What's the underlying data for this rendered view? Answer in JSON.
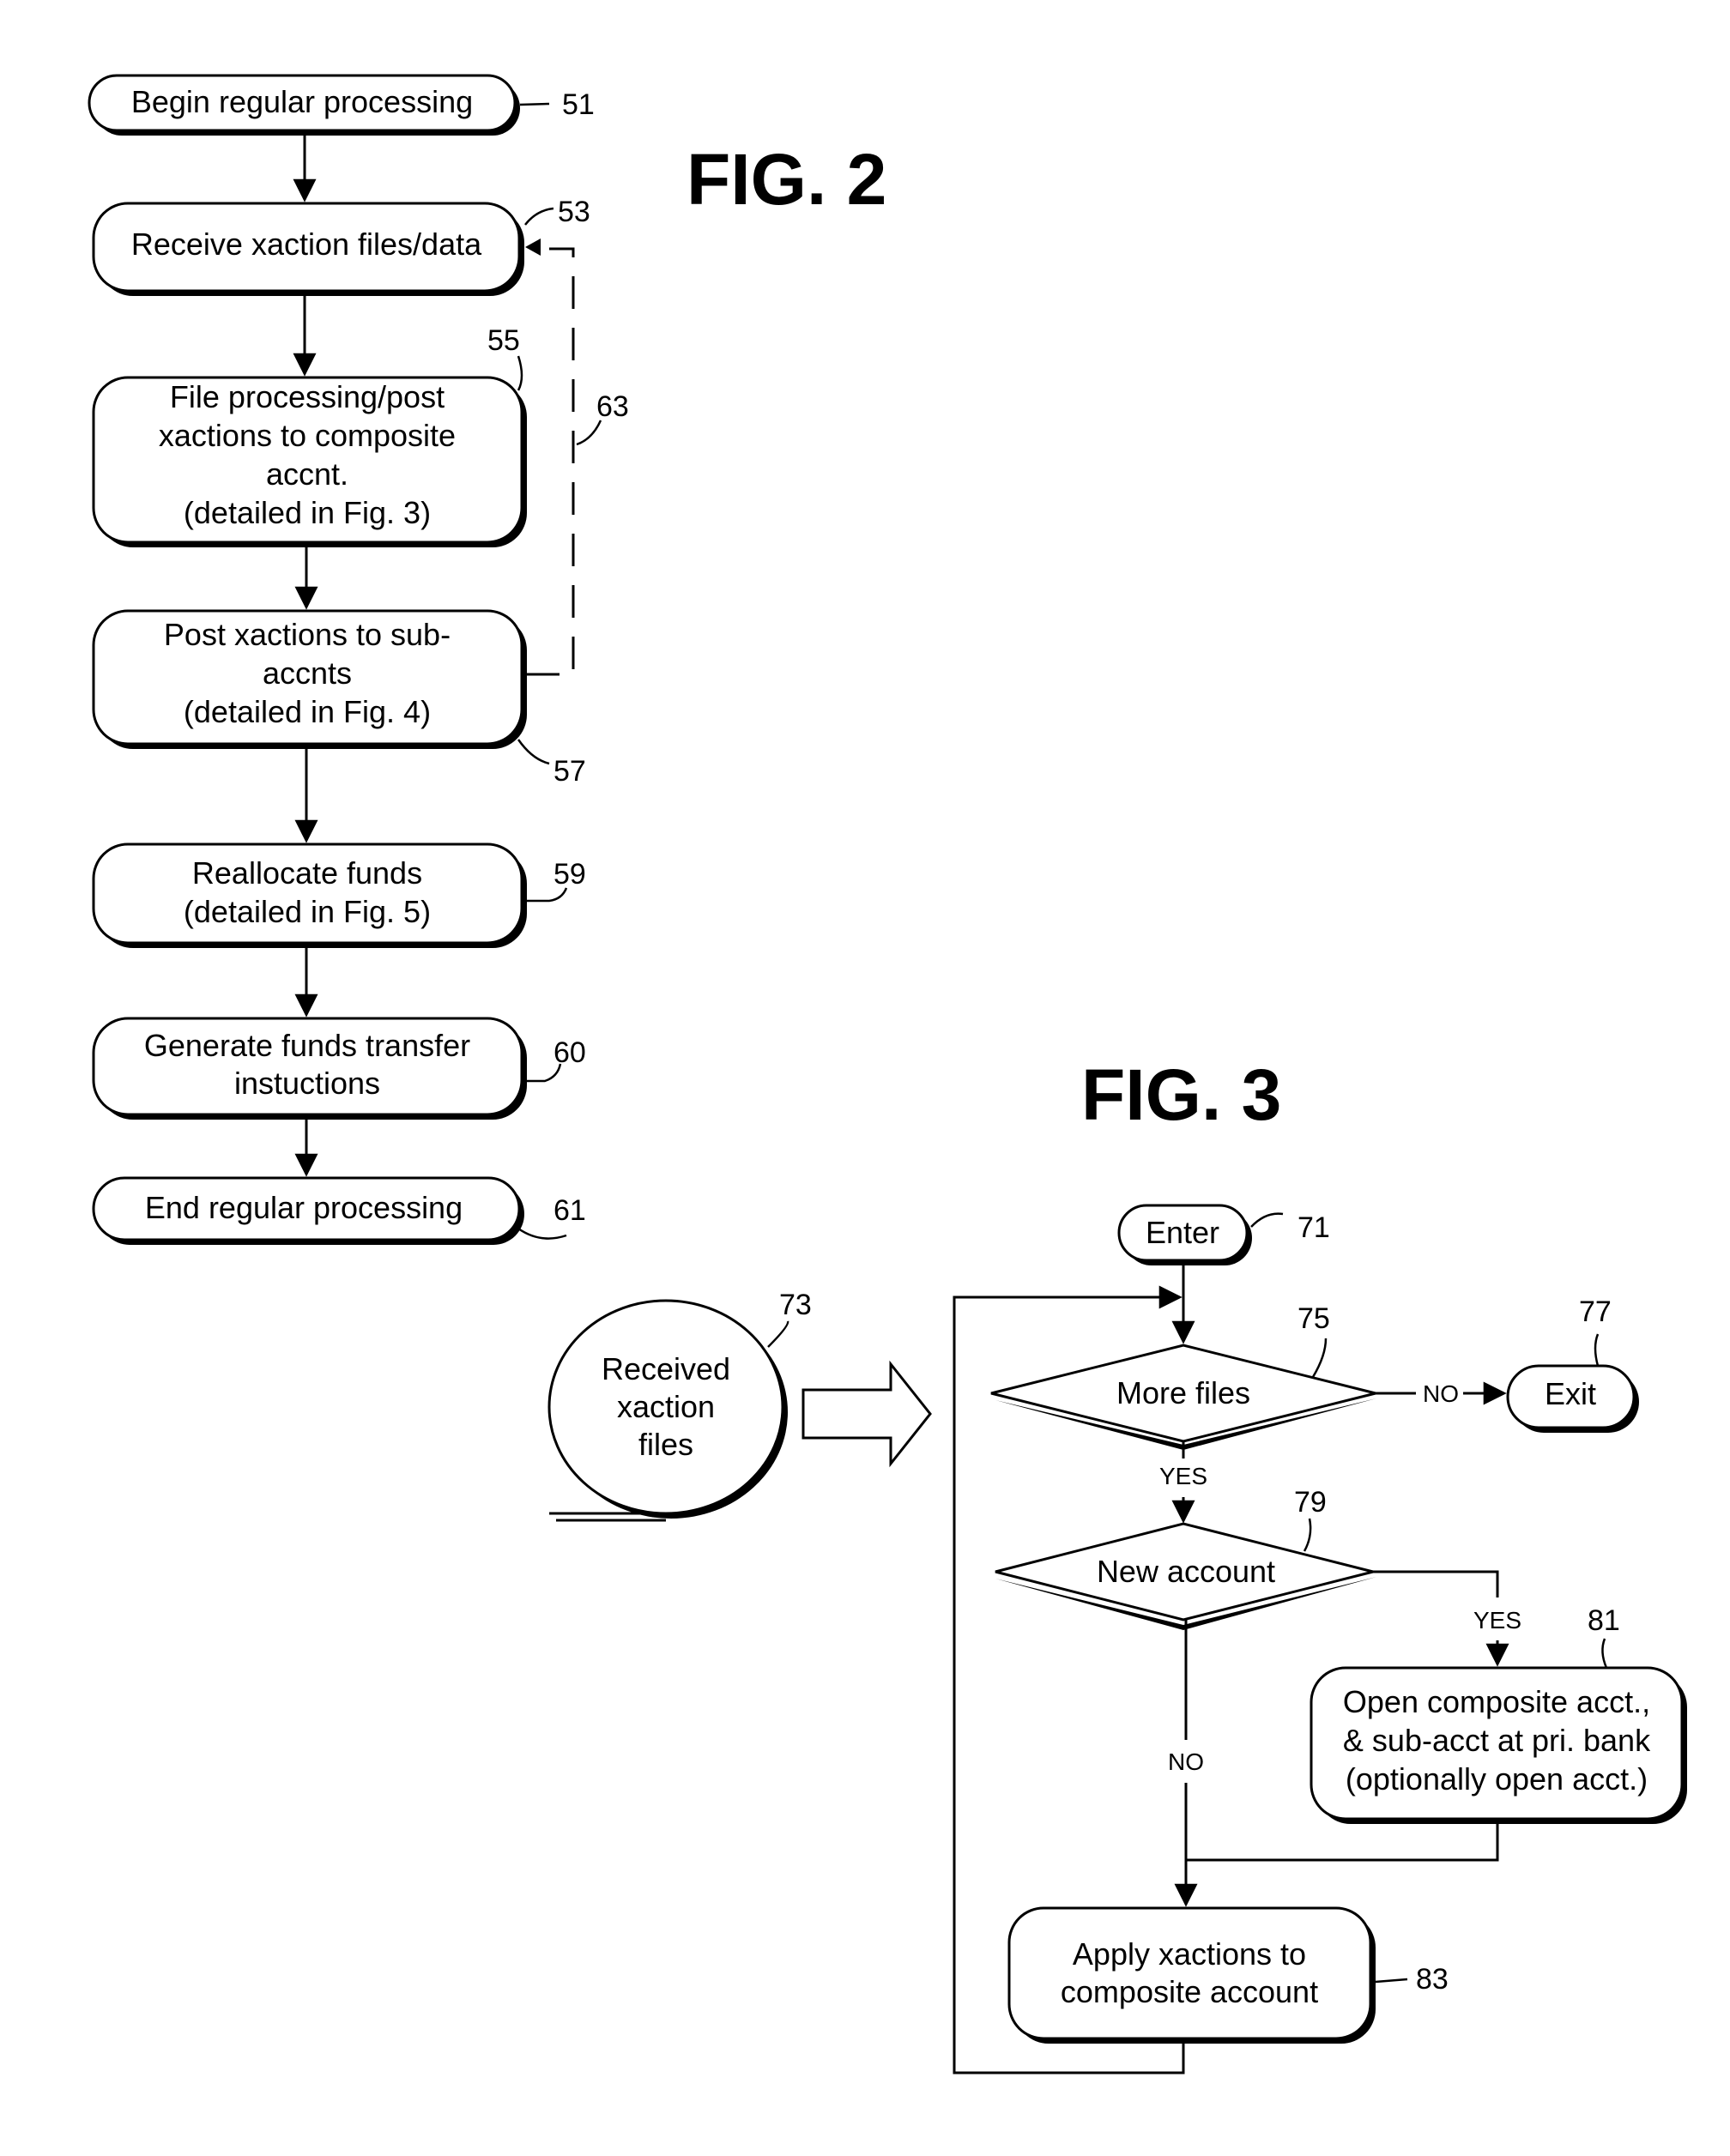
{
  "fig2": {
    "title": "FIG. 2",
    "steps": [
      {
        "ref": "51",
        "lines": [
          "Begin regular processing"
        ],
        "shape": "terminal"
      },
      {
        "ref": "53",
        "lines": [
          "Receive xaction files/data"
        ],
        "shape": "process"
      },
      {
        "ref": "55",
        "lines": [
          "File processing/post",
          "xactions to composite",
          "accnt.",
          "(detailed in Fig. 3)"
        ],
        "shape": "process"
      },
      {
        "ref": "57",
        "lines": [
          "Post xactions to sub-",
          "accnts",
          "(detailed in Fig. 4)"
        ],
        "shape": "process"
      },
      {
        "ref": "59",
        "lines": [
          "Reallocate funds",
          "(detailed in Fig. 5)"
        ],
        "shape": "process"
      },
      {
        "ref": "60",
        "lines": [
          "Generate funds transfer",
          "instuctions"
        ],
        "shape": "process"
      },
      {
        "ref": "61",
        "lines": [
          "End regular processing"
        ],
        "shape": "terminal"
      }
    ],
    "loop_ref": "63"
  },
  "fig3": {
    "title": "FIG. 3",
    "enter": {
      "ref": "71",
      "label": "Enter"
    },
    "input": {
      "ref": "73",
      "lines": [
        "Received",
        "xaction",
        "files"
      ]
    },
    "more_files": {
      "ref": "75",
      "label": "More files"
    },
    "exit": {
      "ref": "77",
      "label": "Exit"
    },
    "new_account": {
      "ref": "79",
      "label": "New account"
    },
    "open_account": {
      "ref": "81",
      "lines": [
        "Open composite acct.,",
        "& sub-acct at pri. bank",
        "(optionally open acct.)"
      ]
    },
    "apply": {
      "ref": "83",
      "lines": [
        "Apply xactions to",
        "composite account"
      ]
    },
    "yes_label": "YES",
    "no_label": "NO"
  }
}
